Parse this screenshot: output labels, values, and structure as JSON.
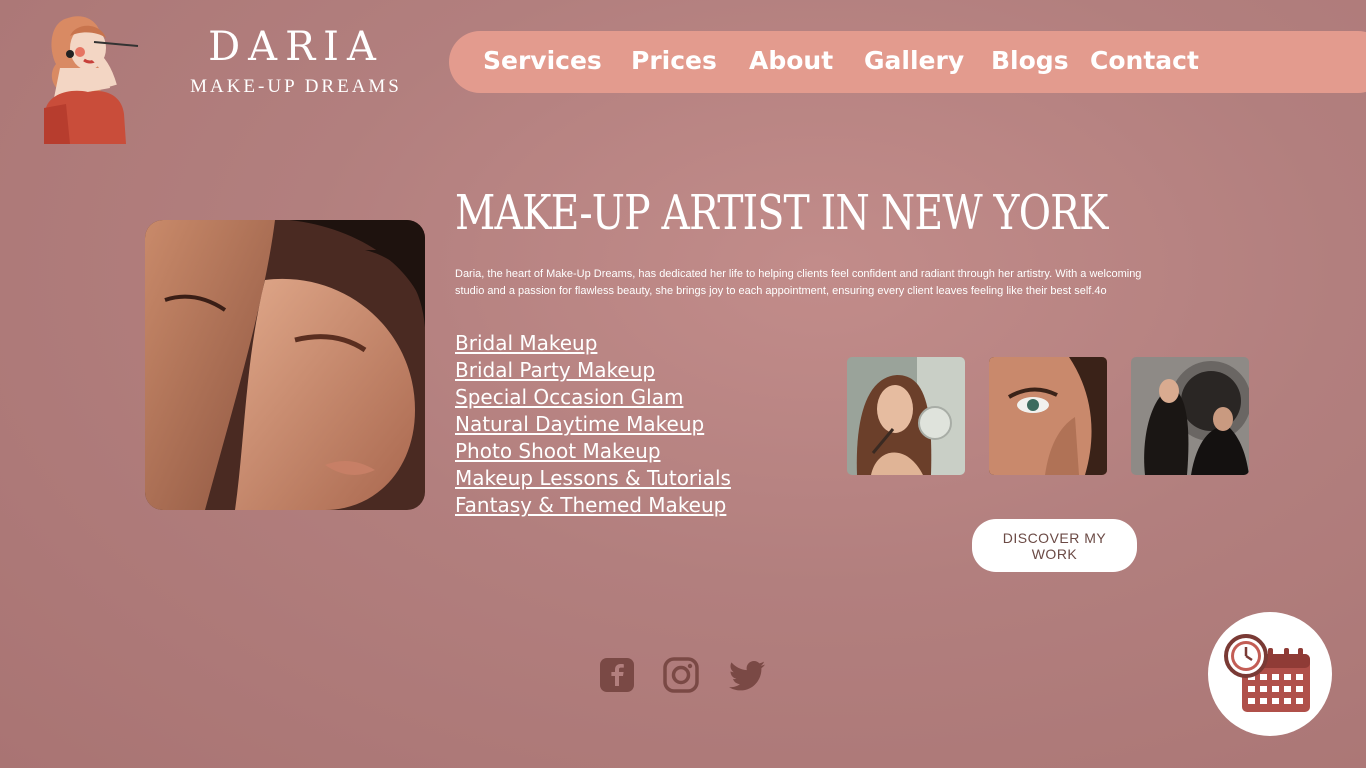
{
  "brand": {
    "name": "DARIA",
    "tagline": "MAKE-UP DREAMS"
  },
  "nav": {
    "items": [
      "Services",
      "Prices",
      "About",
      "Gallery",
      "Blogs",
      "Contact"
    ]
  },
  "hero": {
    "headline": "MAKE-UP ARTIST IN NEW YORK",
    "intro": "Daria, the heart of Make-Up Dreams, has dedicated her life to helping clients feel confident and radiant through her artistry. With a welcoming studio and a passion for flawless beauty, she brings joy to each appointment, ensuring every client leaves feeling like their best self.4o"
  },
  "services": [
    "Bridal Makeup",
    "Bridal Party Makeup",
    "Special Occasion Glam",
    "Natural Daytime Makeup",
    "Photo Shoot Makeup",
    "Makeup Lessons & Tutorials",
    "Fantasy & Themed Makeup"
  ],
  "cta": {
    "discover_label": "DISCOVER MY WORK"
  },
  "social": [
    "facebook-icon",
    "instagram-icon",
    "twitter-icon"
  ],
  "colors": {
    "background": "#b27f7e",
    "nav": "#e39b8e",
    "accent_dark": "#7a4945",
    "button_text": "#6b4a45"
  }
}
